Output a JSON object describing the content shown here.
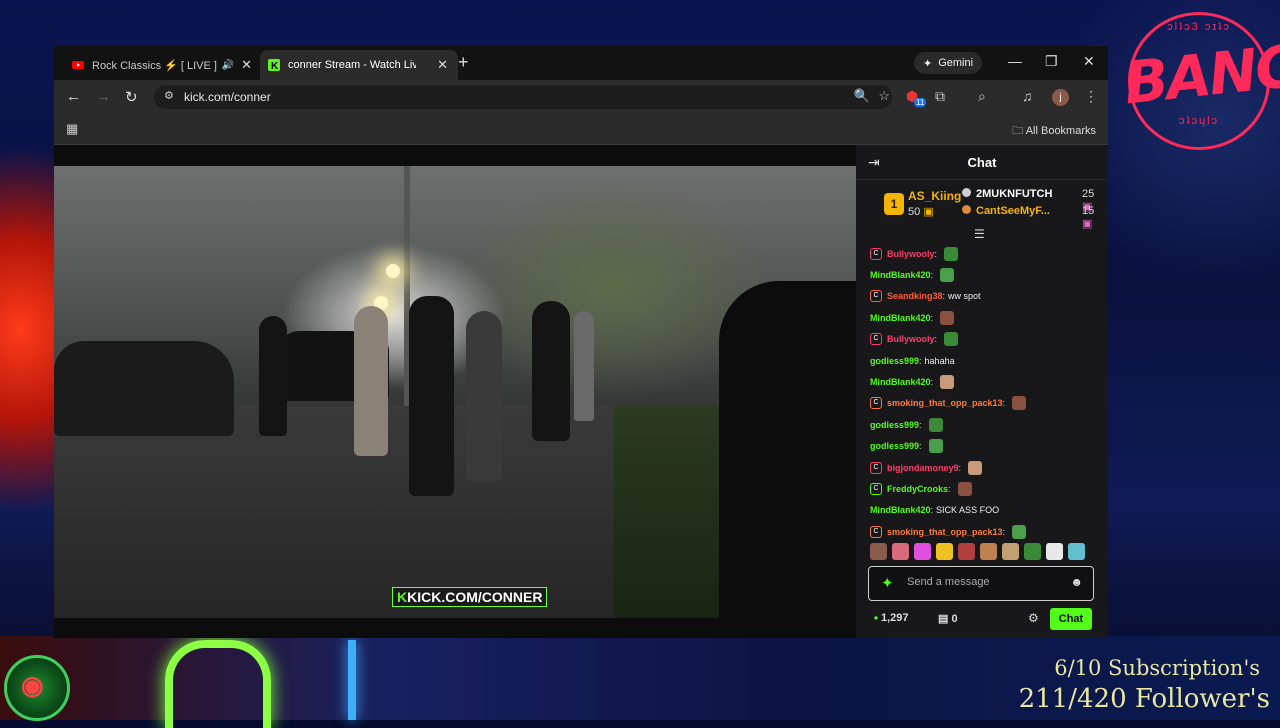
{
  "overlay": {
    "bang_text": "BANG",
    "seal_top": "ɔlʇɔ3 ɔɪʇɔ",
    "seal_bottom": "ɔʇɔɥlɔ",
    "subscriptions": "6/10 Subscription's",
    "followers": "211/420 Follower's"
  },
  "browser": {
    "tabs": [
      {
        "title": "Rock Classics ⚡ [ LIVE ] Ti",
        "icon": "youtube-icon"
      },
      {
        "title": "conner Stream - Watch Live on",
        "icon": "kick-icon"
      }
    ],
    "gemini_label": "Gemini",
    "url": "kick.com/conner",
    "extension_badge": "11",
    "profile_initial": "j",
    "all_bookmarks": "All Bookmarks"
  },
  "video": {
    "watermark_k": "K",
    "watermark_text": "KICK.COM/CONNER"
  },
  "chat": {
    "title": "Chat",
    "leaderboard": {
      "top": {
        "rank": "1",
        "name": "AS_Kiing",
        "score": "50"
      },
      "others": [
        {
          "name": "2MUKNFUTCH",
          "score": "25"
        },
        {
          "name": "CantSeeMyF...",
          "score": "15"
        }
      ]
    },
    "messages": [
      {
        "user": "Bullywooly",
        "color": "#ff3b6b",
        "badge": "C",
        "text": ""
      },
      {
        "user": "MindBlank420",
        "color": "#53fc18",
        "badge": "",
        "text": ""
      },
      {
        "user": "Seandking38",
        "color": "#ff5c3a",
        "badge": "C",
        "text": "ww spot"
      },
      {
        "user": "MindBlank420",
        "color": "#53fc18",
        "badge": "",
        "text": ""
      },
      {
        "user": "Bullywooly",
        "color": "#ff3b6b",
        "badge": "C",
        "text": ""
      },
      {
        "user": "godless999",
        "color": "#53fc18",
        "badge": "",
        "text": "hahaha"
      },
      {
        "user": "MindBlank420",
        "color": "#53fc18",
        "badge": "",
        "text": ""
      },
      {
        "user": "smoking_that_opp_pack13",
        "color": "#ff7a3a",
        "badge": "C",
        "text": ""
      },
      {
        "user": "godless999",
        "color": "#53fc18",
        "badge": "",
        "text": ""
      },
      {
        "user": "godless999",
        "color": "#53fc18",
        "badge": "",
        "text": ""
      },
      {
        "user": "bigjondamoney9",
        "color": "#ff3b6b",
        "badge": "C",
        "text": ""
      },
      {
        "user": "FreddyCrooks",
        "color": "#53fc18",
        "badge": "C",
        "text": ""
      },
      {
        "user": "MindBlank420",
        "color": "#53fc18",
        "badge": "",
        "text": "SICK ASS FOO"
      },
      {
        "user": "smoking_that_opp_pack13",
        "color": "#ff7a3a",
        "badge": "C",
        "text": ""
      }
    ],
    "input_placeholder": "Send a message",
    "points": "1,297",
    "gifts": "0",
    "send_label": "Chat"
  }
}
